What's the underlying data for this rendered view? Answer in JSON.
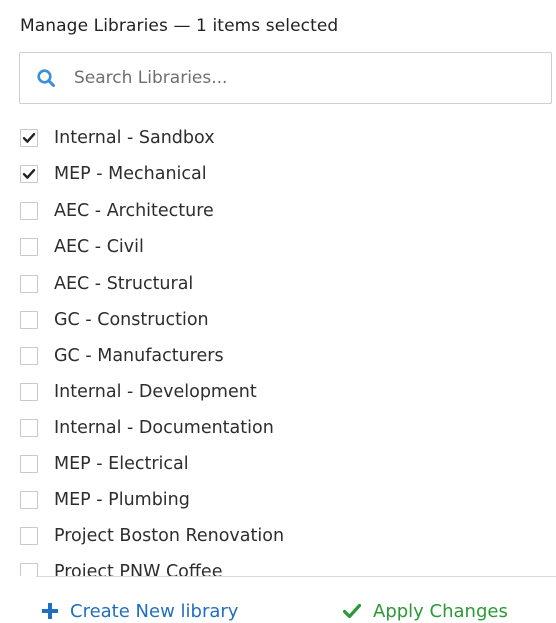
{
  "panel": {
    "title": "Manage Libraries — 1 items selected"
  },
  "search": {
    "placeholder": "Search Libraries...",
    "value": "",
    "icon": "search-icon"
  },
  "libraries": [
    {
      "label": "Internal - Sandbox",
      "checked": true
    },
    {
      "label": "MEP - Mechanical",
      "checked": true
    },
    {
      "label": "AEC - Architecture",
      "checked": false
    },
    {
      "label": "AEC - Civil",
      "checked": false
    },
    {
      "label": "AEC - Structural",
      "checked": false
    },
    {
      "label": "GC - Construction",
      "checked": false
    },
    {
      "label": "GC - Manufacturers",
      "checked": false
    },
    {
      "label": "Internal - Development",
      "checked": false
    },
    {
      "label": "Internal - Documentation",
      "checked": false
    },
    {
      "label": "MEP - Electrical",
      "checked": false
    },
    {
      "label": "MEP - Plumbing",
      "checked": false
    },
    {
      "label": "Project Boston Renovation",
      "checked": false
    },
    {
      "label": "Project PNW Coffee",
      "checked": false
    }
  ],
  "footer": {
    "create_label": "Create New library",
    "create_icon": "plus-icon",
    "apply_label": "Apply Changes",
    "apply_icon": "checkmark-icon"
  },
  "colors": {
    "search_icon": "#3a8fd8",
    "create_button": "#1f6fbf",
    "apply_button": "#2a9a36"
  }
}
